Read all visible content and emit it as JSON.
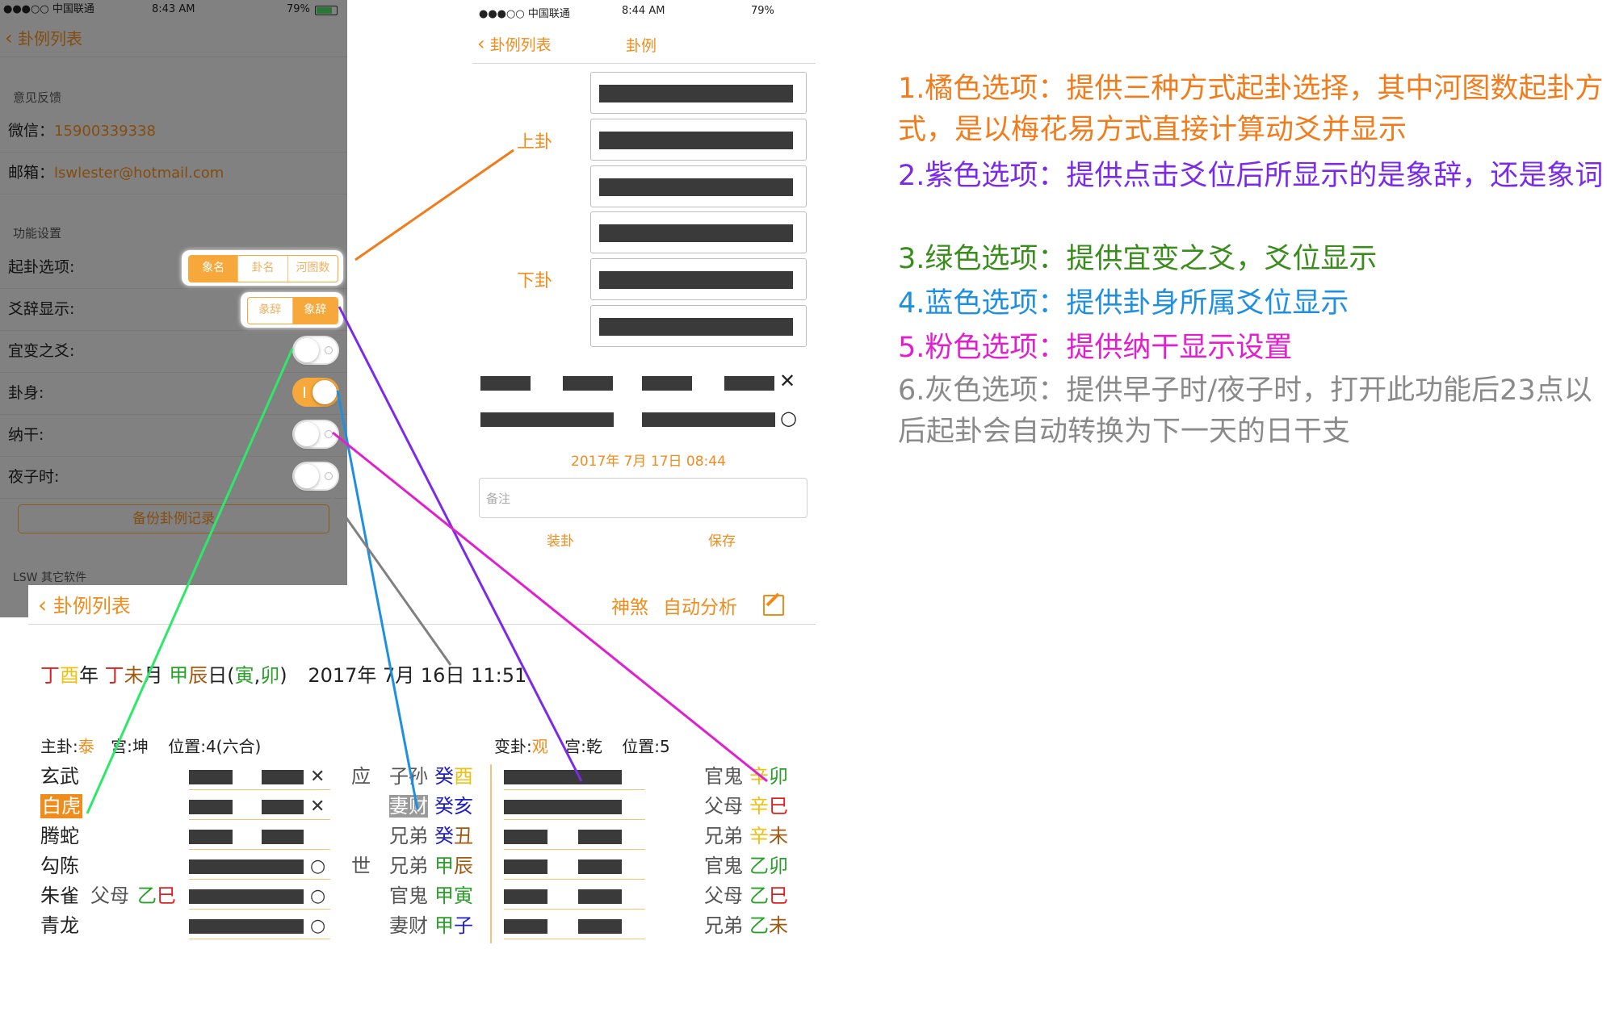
{
  "status_bar_left": {
    "carrier": "●●●○○ 中国联通",
    "time": "8:43 AM",
    "battery": "79%"
  },
  "status_bar_mid": {
    "carrier": "●●●○○ 中国联通",
    "time": "8:44 AM",
    "battery": "79%"
  },
  "settings": {
    "back_label": "卦例列表",
    "feedback_section": "意见反馈",
    "wechat_label": "微信：",
    "wechat_value": "15900339338",
    "email_label": "邮箱：",
    "email_value": "lswlester@hotmail.com",
    "function_section": "功能设置",
    "rows": [
      {
        "label": "起卦选项:"
      },
      {
        "label": "爻辞显示:"
      },
      {
        "label": "宜变之爻:"
      },
      {
        "label": "卦身:"
      },
      {
        "label": "纳干:"
      },
      {
        "label": "夜子时:"
      }
    ],
    "qigua_options": [
      "象名",
      "卦名",
      "河图数"
    ],
    "qigua_selected": 0,
    "yaoci_options": [
      "彖辞",
      "象辞"
    ],
    "yaoci_selected": 1,
    "toggles": {
      "yibian": false,
      "guashen": true,
      "nagan": false,
      "yezishi": false
    },
    "backup_button": "备份卦例记录",
    "other_section": "LSW 其它软件"
  },
  "gua_form": {
    "back_label": "卦例列表",
    "title": "卦例",
    "upper_label": "上卦",
    "lower_label": "下卦",
    "date_text": "2017年 7月 17日 08:44",
    "note_placeholder": "备注",
    "zhuanggua_button": "装卦",
    "save_button": "保存",
    "yao_marks": [
      "✕",
      "○"
    ]
  },
  "gua_result": {
    "back_label": "卦例列表",
    "shensha_button": "神煞",
    "auto_analysis_button": "自动分析",
    "edit_icon": "edit-icon",
    "ganzhi": {
      "year_gan": "丁",
      "year_zhi": "酉",
      "year_suffix": "年",
      "month_gan": "丁",
      "month_zhi": "未",
      "month_suffix": "月",
      "day_gan": "甲",
      "day_zhi": "辰",
      "day_suffix": "日(",
      "kong1": "寅",
      "comma": ",",
      "kong2": "卯",
      "close": ")",
      "datetime": "2017年 7月 16日 11:51"
    },
    "main_gua": {
      "prefix": "主卦:",
      "name": "泰",
      "palace": "宫:坤",
      "position": "位置:4(六合)"
    },
    "change_gua": {
      "prefix": "变卦:",
      "name": "观",
      "palace": "宫:乾",
      "position": "位置:5"
    },
    "liushen": [
      "玄武",
      "白虎",
      "腾蛇",
      "勾陈",
      "朱雀",
      "青龙"
    ],
    "fushen": {
      "relation": "父母",
      "gan": "乙",
      "zhi": "巳"
    },
    "shi_ying": [
      "应",
      "",
      "",
      "世",
      "",
      ""
    ],
    "main_lines": [
      {
        "relation": "子孙",
        "gan": "癸",
        "zhi": "酉"
      },
      {
        "relation": "妻财",
        "gan": "癸",
        "zhi": "亥"
      },
      {
        "relation": "兄弟",
        "gan": "癸",
        "zhi": "丑"
      },
      {
        "relation": "兄弟",
        "gan": "甲",
        "zhi": "辰"
      },
      {
        "relation": "官鬼",
        "gan": "甲",
        "zhi": "寅"
      },
      {
        "relation": "妻财",
        "gan": "甲",
        "zhi": "子"
      }
    ],
    "change_lines": [
      {
        "relation": "官鬼",
        "gan": "辛",
        "zhi": "卯"
      },
      {
        "relation": "父母",
        "gan": "辛",
        "zhi": "巳"
      },
      {
        "relation": "兄弟",
        "gan": "辛",
        "zhi": "未"
      },
      {
        "relation": "官鬼",
        "gan": "乙",
        "zhi": "卯"
      },
      {
        "relation": "父母",
        "gan": "乙",
        "zhi": "巳"
      },
      {
        "relation": "兄弟",
        "gan": "乙",
        "zhi": "未"
      }
    ],
    "main_marks": [
      "✕",
      "✕",
      "",
      "○",
      "○",
      "○"
    ]
  },
  "annotations": [
    {
      "text": "1.橘色选项：提供三种方式起卦选择，其中河图数起卦方式，是以梅花易方式直接计算动爻并显示",
      "color": "#f07c1c"
    },
    {
      "text": "2.紫色选项：提供点击爻位后所显示的是象辞，还是象词",
      "color": "#7b2be8"
    },
    {
      "text": "3.绿色选项：提供宜变之爻，爻位显示",
      "color": "#3a8c1c"
    },
    {
      "text": "4.蓝色选项：提供卦身所属爻位显示",
      "color": "#1f8fe0"
    },
    {
      "text": "5.粉色选项：提供纳干显示设置",
      "color": "#e21fcf"
    },
    {
      "text": "6.灰色选项：提供早子时/夜子时，打开此功能后23点以后起卦会自动转换为下一天的日干支",
      "color": "#8a8a8a"
    }
  ],
  "colors": {
    "accent": "#f7a83a",
    "orange_text": "#f08c1c",
    "fire": "#e02020",
    "wood": "#2aa02a",
    "water": "#2020c0",
    "metal": "#f0c010",
    "earth": "#a05a10"
  }
}
